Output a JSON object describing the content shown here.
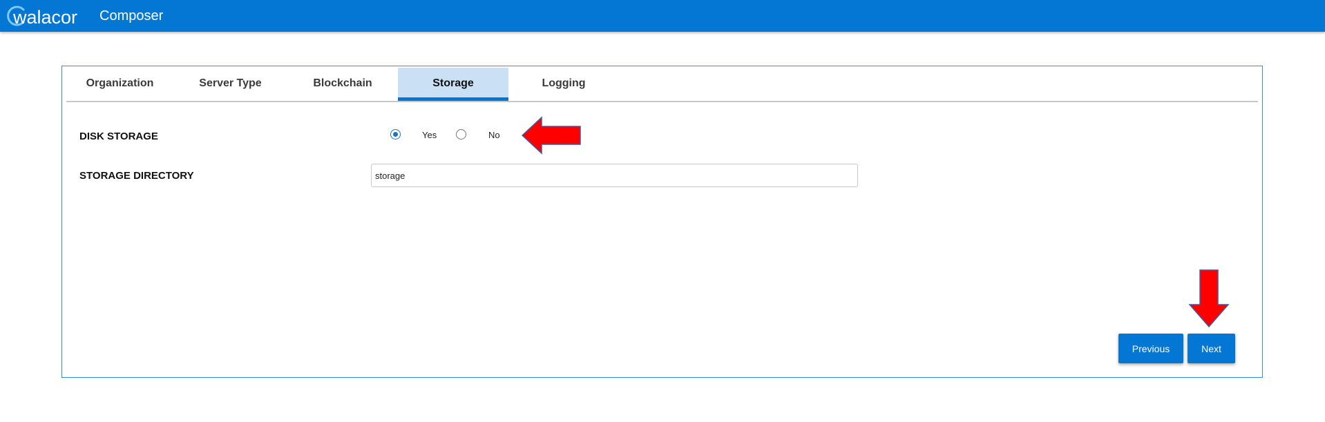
{
  "header": {
    "logo_text": "walacor",
    "app_title": "Composer",
    "bar_color": "#0477d4"
  },
  "tabs": [
    {
      "label": "Organization",
      "active": false
    },
    {
      "label": "Server Type",
      "active": false
    },
    {
      "label": "Blockchain",
      "active": false
    },
    {
      "label": "Storage",
      "active": true
    },
    {
      "label": "Logging",
      "active": false
    }
  ],
  "form": {
    "disk_storage": {
      "label": "DISK STORAGE",
      "options": [
        {
          "label": "Yes",
          "selected": true
        },
        {
          "label": "No",
          "selected": false
        }
      ]
    },
    "storage_directory": {
      "label": "STORAGE DIRECTORY",
      "value": "storage",
      "placeholder": ""
    }
  },
  "buttons": {
    "previous": "Previous",
    "next": "Next"
  },
  "annotations": {
    "arrow_color": "#ff0000",
    "arrow_outline": "#3a5fa8",
    "icons": [
      "left-arrow-icon",
      "down-arrow-icon"
    ]
  }
}
